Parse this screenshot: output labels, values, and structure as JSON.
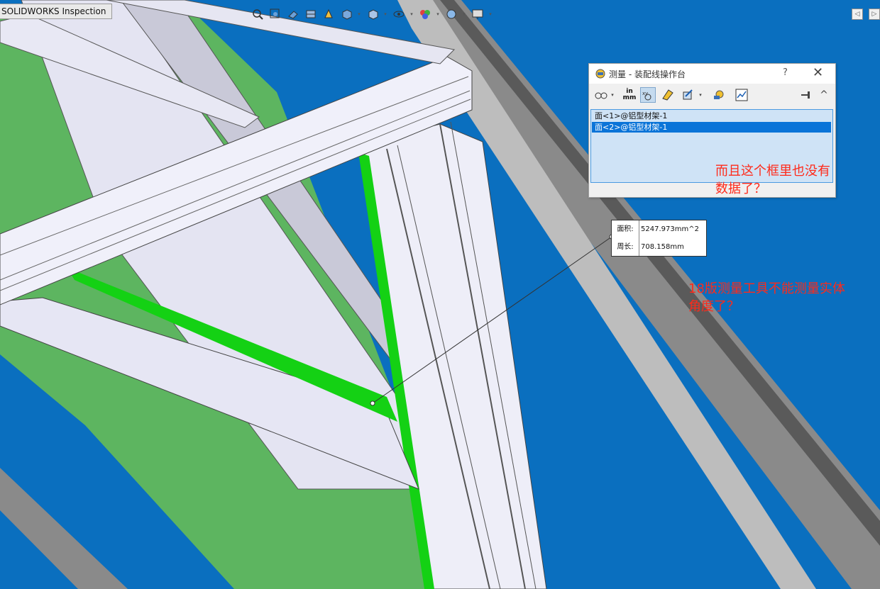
{
  "tab": {
    "label": "SOLIDWORKS Inspection"
  },
  "heads_up_toolbar": {
    "icons": [
      "zoom-to-fit-icon",
      "zoom-to-area-icon",
      "previous-view-icon",
      "section-view-icon",
      "dynamic-annotation-icon",
      "view-orientation-icon",
      "display-style-icon",
      "hide-show-icon",
      "edit-appearance-icon",
      "apply-scene-icon",
      "view-settings-icon"
    ]
  },
  "measure_dialog": {
    "title": "测量 - 装配线操作台",
    "help": "?",
    "close": "✕",
    "toolbar": {
      "arc_circle": "arc-circle-measure-icon",
      "units_top": "in",
      "units_bottom": "mm",
      "show_xyz": "show-xyz-icon",
      "point_to_point": "point-to-point-icon",
      "projection": "projection-icon",
      "measure_history": "measure-history-icon",
      "create_sensor": "create-sensor-icon",
      "pin": "pin-icon",
      "collapse": "collapse-icon"
    },
    "selections": [
      {
        "label": "面<1>@铝型材架-1",
        "selected": false
      },
      {
        "label": "面<2>@铝型材架-1",
        "selected": true
      }
    ]
  },
  "callout": {
    "rows": [
      {
        "label": "面积:",
        "value": "5247.973mm^2"
      },
      {
        "label": "周长:",
        "value": "708.158mm"
      }
    ]
  },
  "annotations": {
    "note1": [
      "而且这个框里也没有",
      "数据了？"
    ],
    "note2": [
      "18版测量工具不能测量实体",
      "角度了？"
    ]
  },
  "colors": {
    "background": "#0a6fbf",
    "panel_green": "#5db560",
    "selected_face": "#14d114",
    "beam_face": "#eeeef8",
    "annotation_red": "#ff2a1a",
    "selection_blue": "#0a74d8"
  }
}
